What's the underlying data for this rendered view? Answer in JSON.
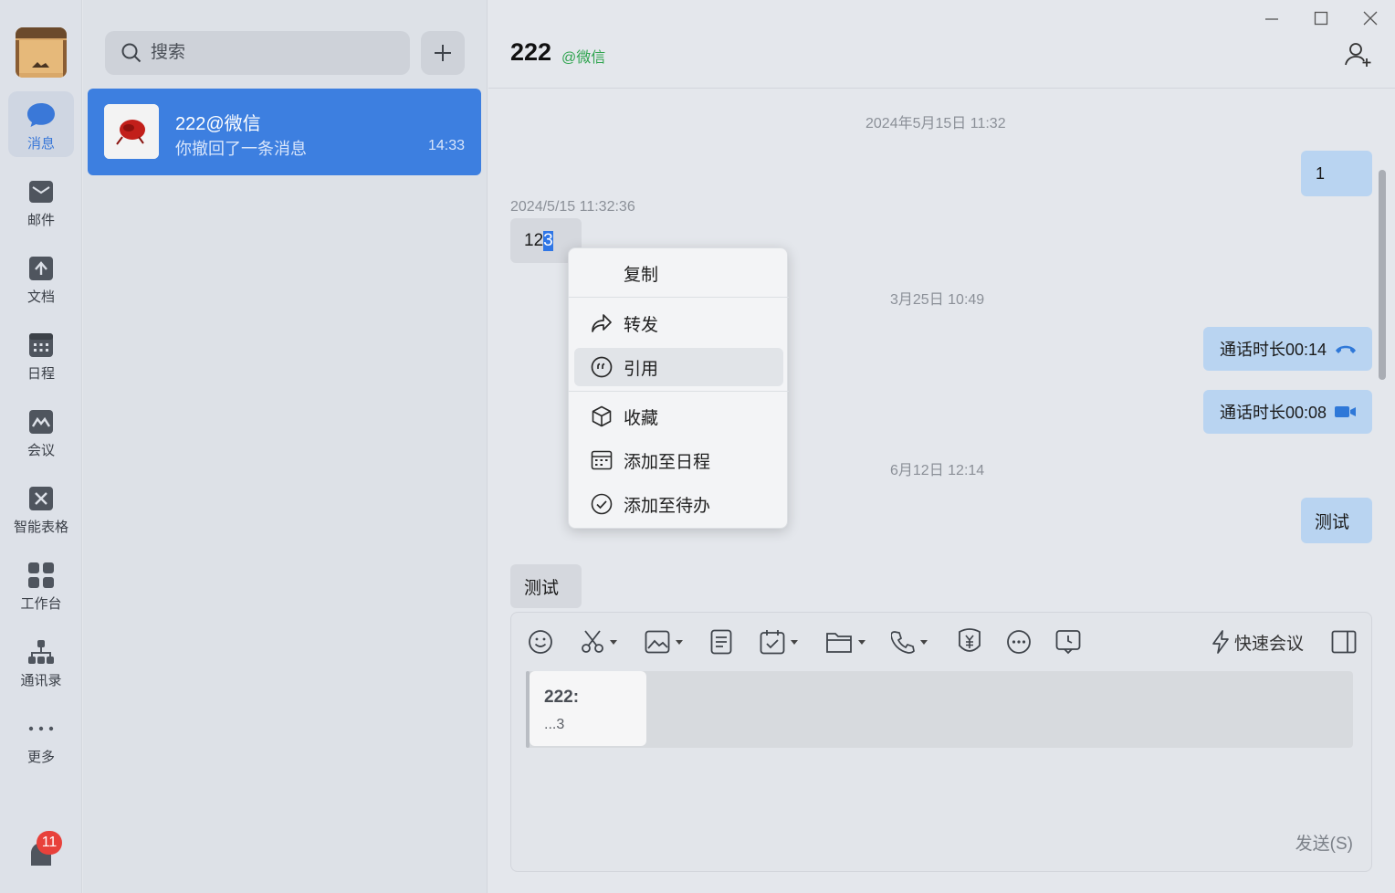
{
  "nav": {
    "items": [
      {
        "label": "消息",
        "icon": "chat-bubble-icon"
      },
      {
        "label": "邮件",
        "icon": "mail-icon"
      },
      {
        "label": "文档",
        "icon": "document-icon"
      },
      {
        "label": "日程",
        "icon": "calendar-icon"
      },
      {
        "label": "会议",
        "icon": "meeting-icon"
      },
      {
        "label": "智能表格",
        "icon": "smart-sheet-icon"
      },
      {
        "label": "工作台",
        "icon": "workbench-icon"
      },
      {
        "label": "通讯录",
        "icon": "contacts-icon"
      },
      {
        "label": "更多",
        "icon": "more-icon"
      }
    ],
    "badge_count": "11"
  },
  "list": {
    "search_placeholder": "搜索",
    "conversation": {
      "name": "222@微信",
      "preview": "你撤回了一条消息",
      "time": "14:33"
    }
  },
  "chat": {
    "title": "222",
    "subtitle": "@微信",
    "time_sep_1": "2024年5月15日 11:32",
    "msg_mine_1": "1",
    "msg_timestamp": "2024/5/15 11:32:36",
    "msg_theirs_1_prefix": "12",
    "msg_theirs_1_selected": "3",
    "time_sep_2": "3月25日 10:49",
    "call_1": "通话时长00:14",
    "call_2": "通话时长00:08",
    "time_sep_3": "6月12日 12:14",
    "msg_mine_2": "测试",
    "msg_theirs_2": "测试"
  },
  "context_menu": {
    "copy": "复制",
    "forward": "转发",
    "quote": "引用",
    "favorite": "收藏",
    "add_schedule": "添加至日程",
    "add_todo": "添加至待办"
  },
  "composer": {
    "quick_meeting": "快速会议",
    "quote_name": "222:",
    "quote_text": "...3",
    "send_label": "发送(S)"
  },
  "colors": {
    "accent": "#3d7fe0",
    "badge": "#e8413b",
    "subtitle_green": "#2fa44f"
  }
}
